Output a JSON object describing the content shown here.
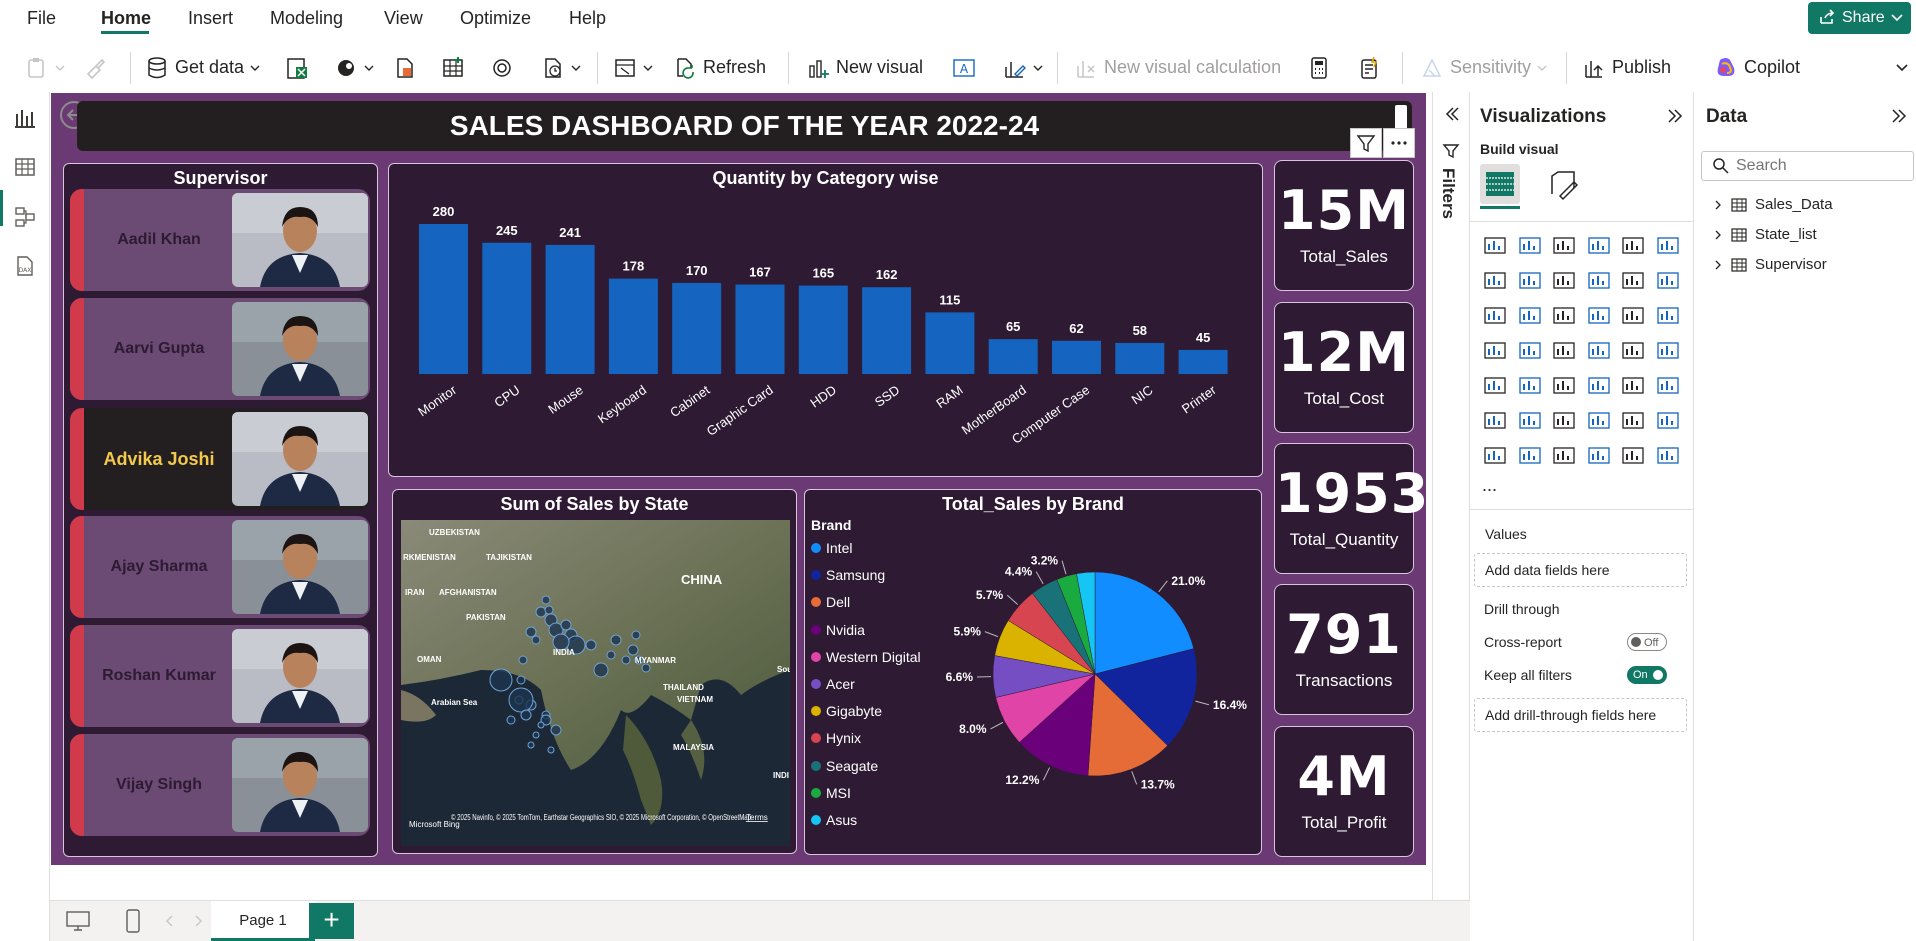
{
  "menu": {
    "items": [
      "File",
      "Home",
      "Insert",
      "Modeling",
      "View",
      "Optimize",
      "Help"
    ],
    "share": "Share"
  },
  "ribbon": {
    "get_data": "Get data",
    "refresh": "Refresh",
    "new_visual": "New visual",
    "new_visual_calc": "New visual calculation",
    "sensitivity": "Sensitivity",
    "publish": "Publish",
    "copilot": "Copilot"
  },
  "report": {
    "title": "SALES DASHBOARD OF THE YEAR 2022-24",
    "supervisor": {
      "title": "Supervisor",
      "names": [
        "Aadil Khan",
        "Aarvi Gupta",
        "Advika Joshi",
        "Ajay Sharma",
        "Roshan Kumar",
        "Vijay Singh"
      ],
      "selected": "Advika Joshi"
    },
    "kpis": [
      {
        "value": "15M",
        "label": "Total_Sales"
      },
      {
        "value": "12M",
        "label": "Total_Cost"
      },
      {
        "value": "1953",
        "label": "Total_Quantity"
      },
      {
        "value": "791",
        "label": "Transactions"
      },
      {
        "value": "4M",
        "label": "Total_Profit"
      }
    ],
    "map": {
      "title": "Sum of Sales by State",
      "labels": [
        "UZBEKISTAN",
        "RKMENISTAN",
        "TAJIKISTAN",
        "AFGHANISTAN",
        "IRAN",
        "PAKISTAN",
        "CHINA",
        "INDIA",
        "OMAN",
        "MYANMAR",
        "THAILAND",
        "VIETNAM",
        "Arabian Sea",
        "MALAYSIA",
        "Sou Chi Se",
        "INDI"
      ],
      "attribution": "© 2025 Navinfo, © 2025 TomTom, Earthstar Geographics SIO, © 2025 Microsoft Corporation, © OpenStreetMap",
      "terms": "Terms",
      "bing": "Microsoft Bing"
    }
  },
  "chart_data": [
    {
      "type": "bar",
      "title": "Quantity by Category wise",
      "categories": [
        "Monitor",
        "CPU",
        "Mouse",
        "Keyboard",
        "Cabinet",
        "Graphic Card",
        "HDD",
        "SSD",
        "RAM",
        "MotherBoard",
        "Computer Case",
        "NIC",
        "Printer"
      ],
      "values": [
        280,
        245,
        241,
        178,
        170,
        167,
        165,
        162,
        115,
        65,
        62,
        58,
        45
      ],
      "color": "#1565c0",
      "ylim": [
        0,
        280
      ]
    },
    {
      "type": "pie",
      "title": "Total_Sales by Brand",
      "legend_title": "Brand",
      "categories": [
        "Intel",
        "Samsung",
        "Dell",
        "Nvidia",
        "Western Digital",
        "Acer",
        "Gigabyte",
        "Hynix",
        "Seagate",
        "MSI",
        "Asus"
      ],
      "values": [
        21.0,
        16.4,
        13.7,
        12.2,
        8.0,
        6.6,
        5.9,
        5.7,
        4.4,
        3.2,
        2.9
      ],
      "labels": [
        "21.0%",
        "16.4%",
        "13.7%",
        "12.2%",
        "8.0%",
        "6.6%",
        "5.9%",
        "5.7%",
        "4.4%",
        "3.2%",
        ""
      ],
      "colors": [
        "#118dff",
        "#12239e",
        "#e66c37",
        "#6b007b",
        "#e044a7",
        "#744ec2",
        "#d9b300",
        "#d64550",
        "#197278",
        "#1aab40",
        "#15c6f4"
      ]
    }
  ],
  "panes": {
    "filters": "Filters",
    "visualizations": "Visualizations",
    "build_visual": "Build visual",
    "more": "...",
    "values": "Values",
    "add_fields": "Add data fields here",
    "drill_through": "Drill through",
    "cross_report": "Cross-report",
    "cross_report_state": "Off",
    "keep_filters": "Keep all filters",
    "keep_filters_state": "On",
    "add_drill": "Add drill-through fields here",
    "data": "Data",
    "search_placeholder": "Search",
    "tables": [
      "Sales_Data",
      "State_list",
      "Supervisor"
    ]
  },
  "bottom": {
    "page": "Page 1",
    "add": "+"
  }
}
